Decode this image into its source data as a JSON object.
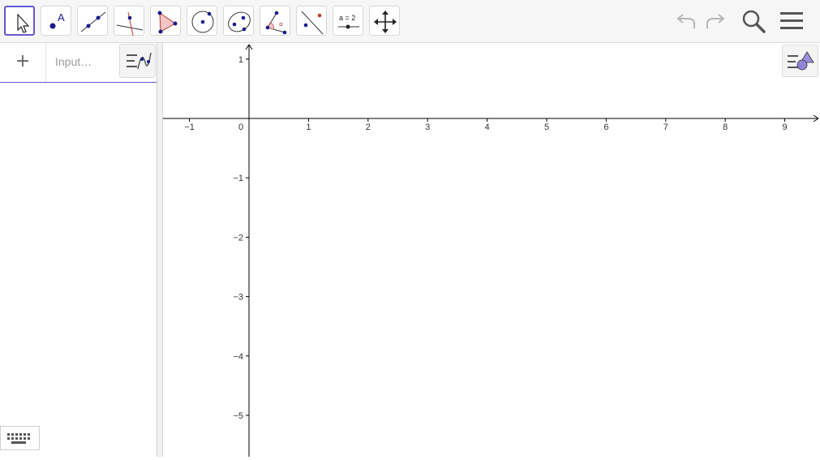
{
  "toolbar": {
    "tools": [
      {
        "name": "Move",
        "icon": "move-arrow-icon"
      },
      {
        "name": "Point",
        "icon": "point-icon",
        "label": "A"
      },
      {
        "name": "Line",
        "icon": "line-icon"
      },
      {
        "name": "Perpendicular Line",
        "icon": "perpendicular-line-icon"
      },
      {
        "name": "Polygon",
        "icon": "polygon-icon"
      },
      {
        "name": "Circle with Center through Point",
        "icon": "circle-icon"
      },
      {
        "name": "Ellipse",
        "icon": "ellipse-icon"
      },
      {
        "name": "Angle",
        "icon": "angle-icon",
        "label": "α"
      },
      {
        "name": "Reflect about Line",
        "icon": "reflect-icon"
      },
      {
        "name": "Slider",
        "icon": "slider-icon",
        "label": "a = 2"
      },
      {
        "name": "Move Graphics View",
        "icon": "move-graphics-icon"
      }
    ],
    "selected_tool": "Move",
    "undo_icon": "undo-icon",
    "redo_icon": "redo-icon",
    "search_icon": "search-icon",
    "menu_icon": "hamburger-menu-icon"
  },
  "algebra": {
    "add_symbol": "+",
    "input_placeholder": "Input…"
  },
  "graphics": {
    "x_ticks": [
      "−1",
      "0",
      "1",
      "2",
      "3",
      "4",
      "5",
      "6",
      "7",
      "8",
      "9"
    ],
    "y_ticks": [
      "1",
      "−1",
      "−2",
      "−3",
      "−4",
      "−5"
    ],
    "x_range": [
      -1.4,
      9.6
    ],
    "y_range": [
      -5.6,
      1.25
    ]
  },
  "keyboard": {
    "icon": "keyboard-icon"
  },
  "colors": {
    "accent": "#6557d2",
    "point": "#1a1a8c",
    "axis": "#000000"
  }
}
